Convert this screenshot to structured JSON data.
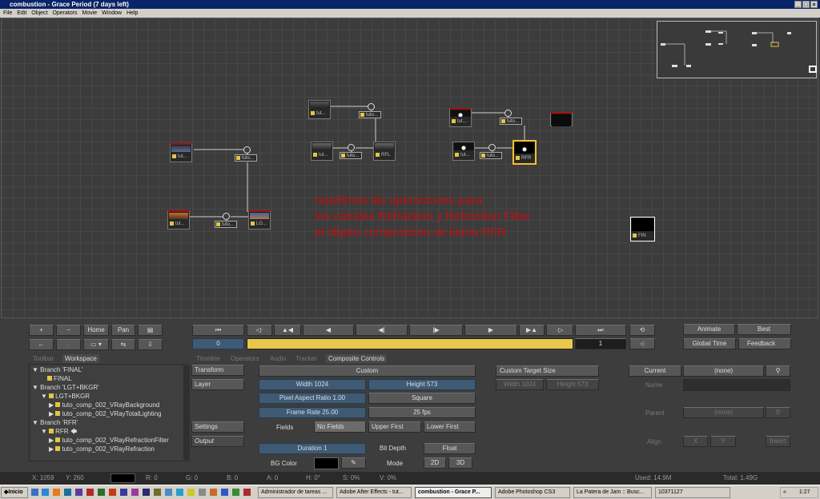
{
  "window": {
    "title": "combustion - Grace Period (7 days left)"
  },
  "menu": [
    "File",
    "Edit",
    "Object",
    "Operators",
    "Movie",
    "Window",
    "Help"
  ],
  "nodes": {
    "n1": "tut...",
    "n2": "tuto...",
    "n3": "tut...",
    "n4": "tuto...",
    "n5": "LG...",
    "n6": "tut...",
    "n7": "tuto...",
    "n8": "tut...",
    "n9": "tuto...",
    "n10": "RFL",
    "n11": "tut...",
    "n12": "tuto...",
    "n13": "tut...",
    "n14": "tuto...",
    "n15": "RFR",
    "n16": "FIN"
  },
  "annotation": [
    "repetimos las operaciones para",
    "los canales Refraction y Refraction Filter",
    "el objeto composicion se llama RFR"
  ],
  "nav": {
    "home": "Home",
    "pan": "Pan"
  },
  "timeline": {
    "start_frame": "0",
    "end_frame": "1"
  },
  "render": {
    "animate": "Animate",
    "quality": "Best",
    "global_time": "Global Time",
    "feedback": "Feedback"
  },
  "tabs_left": [
    "Toolbar",
    "Workspace"
  ],
  "tabs_right": [
    "Timeline",
    "Operators",
    "Audio",
    "Tracker",
    "Composite Controls"
  ],
  "tree": [
    "Branch 'FINAL'",
    "FINAL",
    "Branch 'LGT+BKGR'",
    "LGT+BKGR",
    "tuto_comp_002_VRayBackground",
    "tuto_comp_002_VRayTotalLighting",
    "Branch 'RFR'",
    "RFR",
    "tuto_comp_002_VRayRefractionFilter",
    "tuto_comp_002_VRayRefraction"
  ],
  "side_buttons": {
    "transform": "Transform",
    "layer": "Layer",
    "settings": "Settings",
    "output": "Output"
  },
  "composite": {
    "preset": "Custom",
    "width": "Width 1024",
    "height": "Height 573",
    "pixel_aspect": "Pixel Aspect Ratio 1.00",
    "aspect_mode": "Square",
    "frame_rate": "Frame Rate 25.00",
    "fps": "25 fps",
    "fields_label": "Fields",
    "fields_none": "No Fields",
    "upper_first": "Upper First",
    "lower_first": "Lower First",
    "duration": "Duration 1",
    "bit_depth_label": "Bit Depth",
    "bit_depth": "Float",
    "bg_color_label": "BG Color",
    "mode_label": "Mode",
    "mode_2d": "2D",
    "mode_3d": "3D",
    "custom_target": "Custom Target Size",
    "target_w": "Width 1024",
    "target_h": "Height 573"
  },
  "current": {
    "label": "Current",
    "value": "(none)",
    "name_label": "Name",
    "parent_label": "Parent",
    "parent_value": "(none)",
    "align_label": "Align",
    "x": "X",
    "y": "Y",
    "invert": "Invert"
  },
  "status": {
    "x": "X:   1059",
    "y": "Y:   260",
    "r": "R: 0",
    "g": "G: 0",
    "b": "B: 0",
    "a": "A: 0",
    "h": "H: 0°",
    "s": "S: 0%",
    "v": "V: 0%",
    "used": "Used:  14.9M",
    "total": "Total:  1.49G"
  },
  "taskbar": {
    "start": "Inicio",
    "tasks": [
      "Administrador de tareas ...",
      "Adobe After Effects - tut...",
      "combustion - Grace P...",
      "Adobe Photoshop CS3",
      "La Patera de Jam :: Busc...",
      "10371127"
    ],
    "clock": "1:27"
  },
  "colors": {
    "timeline_bar": "#e8c84a",
    "annotation": "#c01010",
    "tile_border_red": "#a11111",
    "selected": "#f0c030"
  }
}
